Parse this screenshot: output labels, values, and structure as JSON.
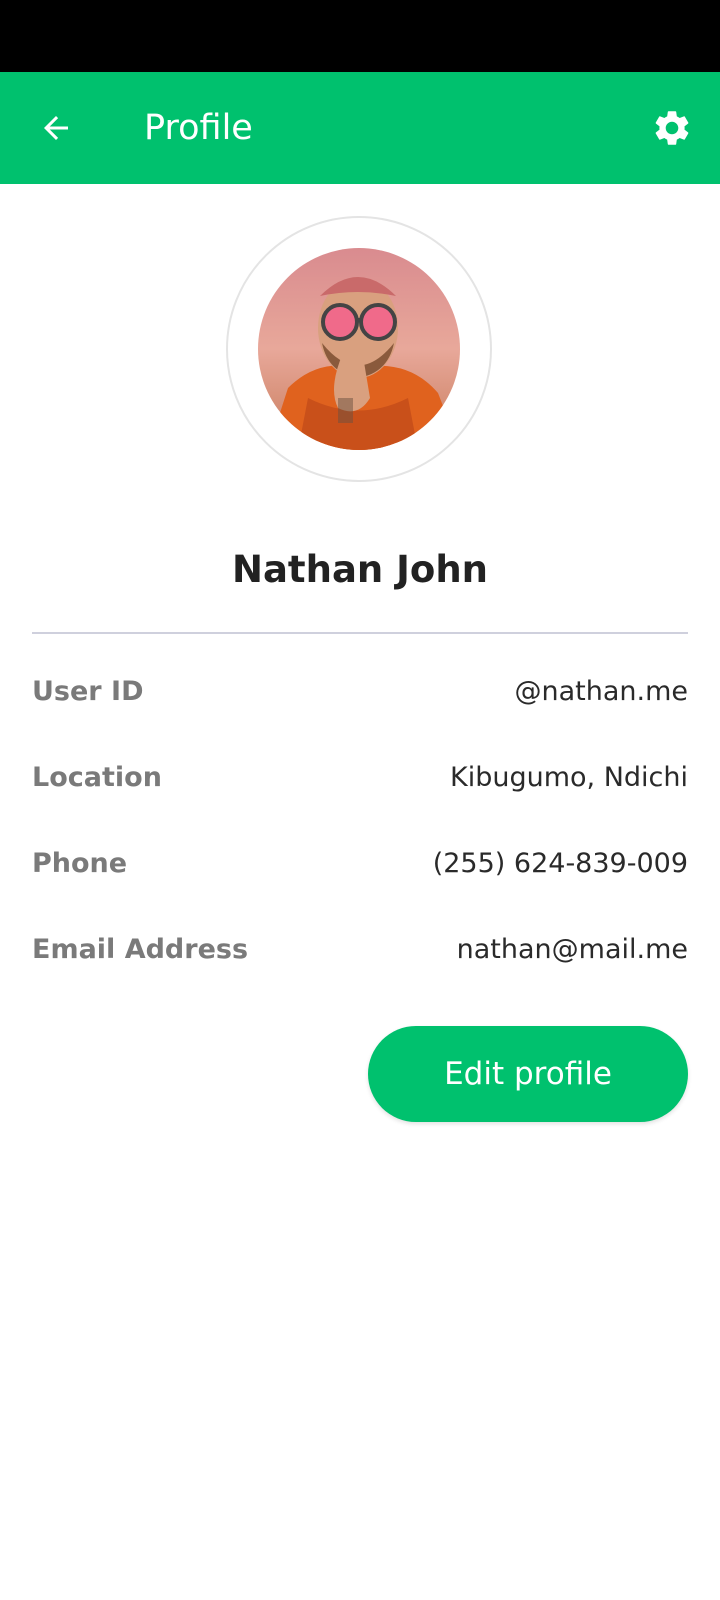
{
  "colors": {
    "accent": "#00c16e",
    "status_bar": "#000000",
    "label": "#7a7a7a",
    "value": "#2a2a2a"
  },
  "app_bar": {
    "title": "Profile",
    "back_icon": "arrow-left-icon",
    "settings_icon": "gear-icon"
  },
  "profile": {
    "name": "Nathan John",
    "avatar_icon": "avatar-photo"
  },
  "info": [
    {
      "label": "User ID",
      "value": "@nathan.me"
    },
    {
      "label": "Location",
      "value": "Kibugumo, Ndichi"
    },
    {
      "label": "Phone",
      "value": "(255) 624-839-009"
    },
    {
      "label": "Email Address",
      "value": "nathan@mail.me"
    }
  ],
  "actions": {
    "edit_label": "Edit profile"
  }
}
